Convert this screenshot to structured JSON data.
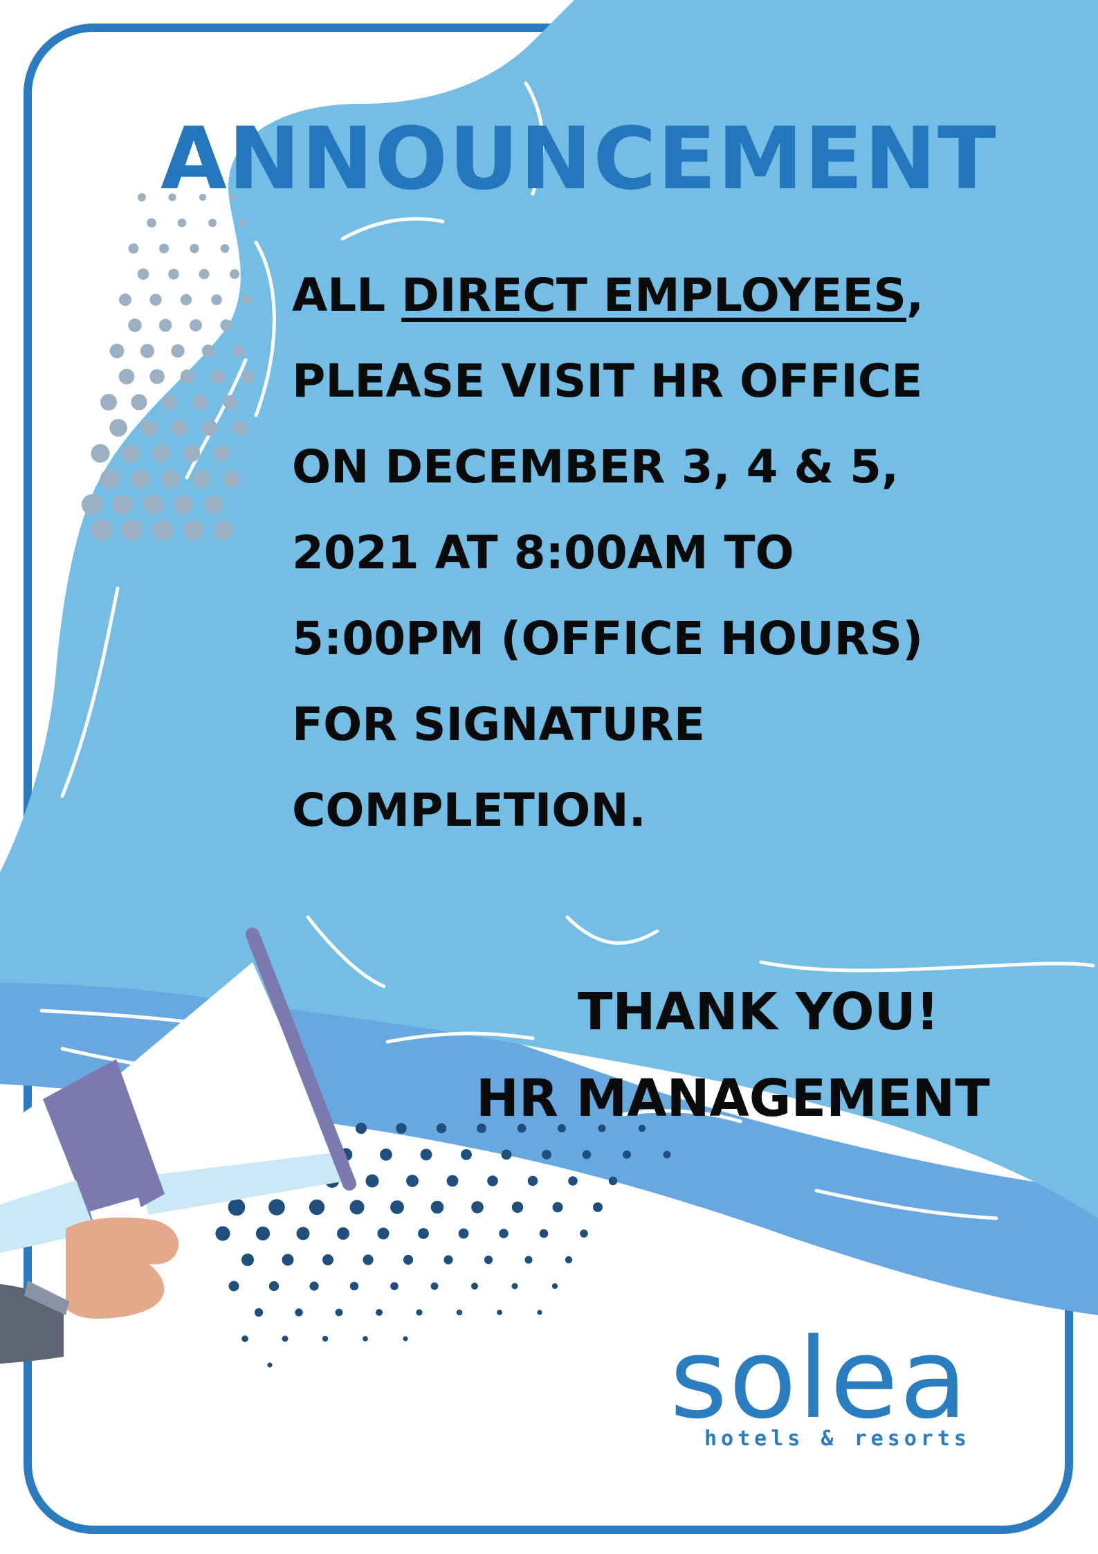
{
  "poster": {
    "headline": "ANNOUNCEMENT",
    "message": {
      "prefix": "ALL ",
      "highlight": "DIRECT EMPLOYEES",
      "suffix": ",",
      "lines": [
        "PLEASE VISIT HR OFFICE",
        "ON DECEMBER 3, 4 & 5,",
        "2021 AT 8:00AM TO",
        "5:00PM (OFFICE HOURS)",
        "FOR SIGNATURE",
        "COMPLETION."
      ]
    },
    "closing": {
      "thanks": "THANK YOU!",
      "signoff": "HR MANAGEMENT"
    }
  },
  "logo": {
    "wordmark": "solea",
    "tagline": "hotels & resorts"
  },
  "colors": {
    "frame_blue": "#2a7bbf",
    "wave_light": "#74bde5",
    "wave_mid": "#68a8e0",
    "headline_blue": "#2577bd",
    "text_black": "#0a0a0a",
    "dot_grey": "#9cb0c4",
    "dot_navy": "#1f4f7c",
    "megaphone_purple": "#7b79b0",
    "hand_skin": "#e4a88a",
    "sleeve_grey": "#5d6474"
  },
  "icons": {
    "megaphone": "megaphone-icon",
    "hand": "hand-icon"
  }
}
